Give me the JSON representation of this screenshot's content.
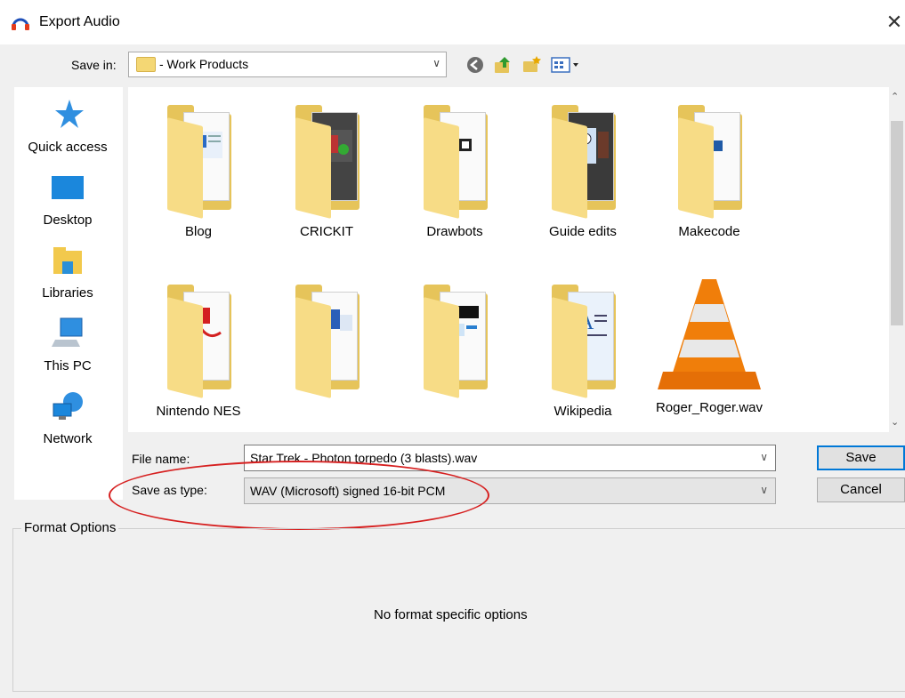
{
  "window": {
    "title": "Export Audio",
    "close_glyph": "✕",
    "app_icon": "audacity-headphones-icon"
  },
  "toolbar": {
    "save_in_label": "Save in:",
    "save_in_value": "- Work Products",
    "icons": [
      "back-icon",
      "up-folder-icon",
      "new-folder-icon",
      "view-menu-icon"
    ]
  },
  "places": [
    {
      "label": "Quick access",
      "icon": "star-icon"
    },
    {
      "label": "Desktop",
      "icon": "desktop-icon"
    },
    {
      "label": "Libraries",
      "icon": "libraries-icon"
    },
    {
      "label": "This PC",
      "icon": "computer-icon"
    },
    {
      "label": "Network",
      "icon": "network-icon"
    }
  ],
  "files": [
    {
      "label": "Blog",
      "icon": "folder-icon"
    },
    {
      "label": "CRICKIT",
      "icon": "folder-icon"
    },
    {
      "label": "Drawbots",
      "icon": "folder-icon"
    },
    {
      "label": "Guide edits",
      "icon": "folder-icon"
    },
    {
      "label": "Makecode",
      "icon": "folder-icon"
    },
    {
      "label": "Nintendo NES",
      "icon": "folder-icon"
    },
    {
      "label": "",
      "icon": "folder-icon"
    },
    {
      "label": "",
      "icon": "folder-icon"
    },
    {
      "label": "Wikipedia",
      "icon": "folder-icon"
    },
    {
      "label": "Roger_Roger.wav",
      "icon": "vlc-cone-icon"
    }
  ],
  "form": {
    "file_name_label": "File name:",
    "file_name_value": "Star Trek - Photon torpedo (3 blasts).wav",
    "save_as_type_label": "Save as type:",
    "save_as_type_value": "WAV (Microsoft) signed 16-bit PCM"
  },
  "buttons": {
    "save": "Save",
    "cancel": "Cancel"
  },
  "format_options": {
    "title": "Format Options",
    "message": "No format specific options"
  },
  "colors": {
    "highlight_ellipse": "#d62020",
    "accent": "#0078d7",
    "folder": "#e6c45a"
  }
}
